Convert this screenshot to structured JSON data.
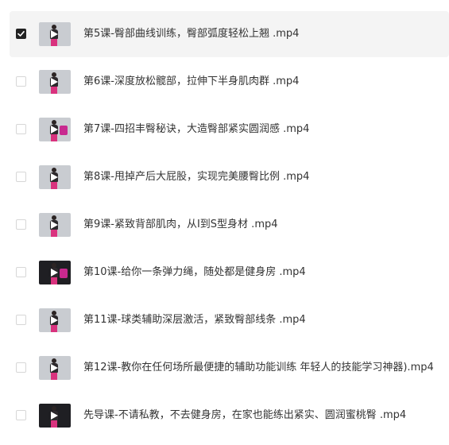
{
  "files": [
    {
      "name": "第5课-臀部曲线训练，臀部弧度轻松上翘 .mp4",
      "checked": true,
      "thumb": "light",
      "accent": false
    },
    {
      "name": "第6课-深度放松髋部，拉伸下半身肌肉群 .mp4",
      "checked": false,
      "thumb": "light",
      "accent": false
    },
    {
      "name": "第7课-四招丰臀秘诀，大造臀部紧实圆润感 .mp4",
      "checked": false,
      "thumb": "light",
      "accent": true
    },
    {
      "name": "第8课-甩掉产后大屁股，实现完美腰臀比例 .mp4",
      "checked": false,
      "thumb": "light",
      "accent": false
    },
    {
      "name": "第9课-紧致背部肌肉，从I到S型身材 .mp4",
      "checked": false,
      "thumb": "light",
      "accent": false
    },
    {
      "name": "第10课-给你一条弹力绳，随处都是健身房 .mp4",
      "checked": false,
      "thumb": "dark",
      "accent": true
    },
    {
      "name": "第11课-球类辅助深层激活，紧致臀部线条 .mp4",
      "checked": false,
      "thumb": "light",
      "accent": false
    },
    {
      "name": "第12课-教你在任何场所最便捷的辅助功能训练  年轻人的技能学习神器).mp4",
      "checked": false,
      "thumb": "light",
      "accent": false
    },
    {
      "name": "先导课-不请私教，不去健身房，在家也能练出紧实、圆润蜜桃臀 .mp4",
      "checked": false,
      "thumb": "dark",
      "accent": false
    }
  ]
}
